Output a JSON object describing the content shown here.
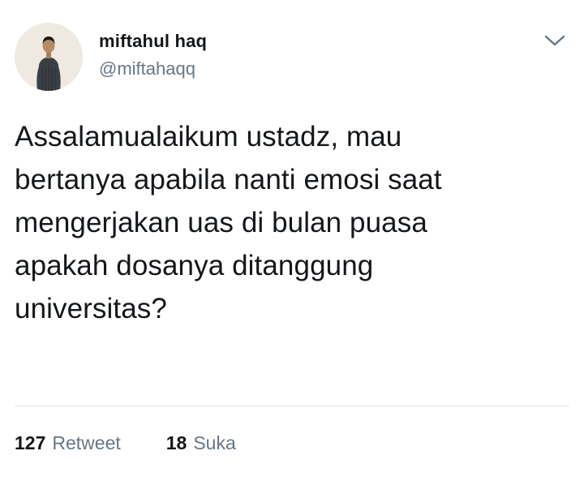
{
  "user": {
    "display_name": "miftahul haq",
    "handle": "@miftahaqq"
  },
  "tweet": {
    "text": "Assalamualaikum ustadz, mau\nbertanya apabila nanti emosi saat\nmengerjakan uas di bulan puasa\napakah dosanya ditanggung\nuniversitas?"
  },
  "stats": {
    "retweets": {
      "count": "127",
      "label": "Retweet"
    },
    "likes": {
      "count": "18",
      "label": "Suka"
    }
  },
  "icons": {
    "menu": "chevron-down-icon",
    "avatar": "avatar"
  },
  "colors": {
    "text": "#14171a",
    "secondary": "#657786",
    "divider": "#e1e8ed"
  }
}
